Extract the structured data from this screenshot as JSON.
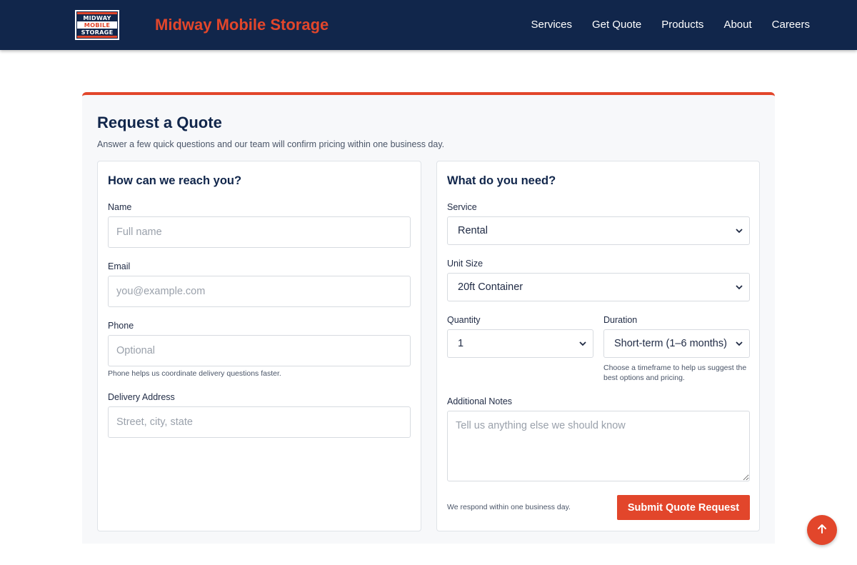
{
  "header": {
    "logo_lines": [
      "MIDWAY",
      "MOBILE",
      "STORAGE"
    ],
    "brand": "Midway Mobile Storage",
    "nav": [
      "Services",
      "Get Quote",
      "Products",
      "About",
      "Careers"
    ]
  },
  "quote": {
    "title": "Request a Quote",
    "subtitle": "Answer a few quick questions and our team will confirm pricing within one business day."
  },
  "contact": {
    "title": "How can we reach you?",
    "name_label": "Name",
    "name_placeholder": "Full name",
    "email_label": "Email",
    "email_placeholder": "you@example.com",
    "phone_label": "Phone",
    "phone_placeholder": "Optional",
    "phone_hint": "Phone helps us coordinate delivery questions faster.",
    "address_label": "Delivery Address",
    "address_placeholder": "Street, city, state"
  },
  "needs": {
    "title": "What do you need?",
    "service_label": "Service",
    "service_value": "Rental",
    "unit_label": "Unit Size",
    "unit_value": "20ft Container",
    "quantity_label": "Quantity",
    "quantity_value": "1",
    "duration_label": "Duration",
    "duration_value": "Short-term (1–6 months)",
    "duration_hint": "Choose a timeframe to help us suggest the best options and pricing.",
    "notes_label": "Additional Notes",
    "notes_placeholder": "Tell us anything else we should know",
    "respond_note": "We respond within one business day.",
    "submit_label": "Submit Quote Request"
  },
  "colors": {
    "navy": "#11264b",
    "accent": "#e2462b"
  },
  "icons": {
    "select_chevron": "chevron-down-icon",
    "scroll_top": "arrow-up-icon"
  }
}
